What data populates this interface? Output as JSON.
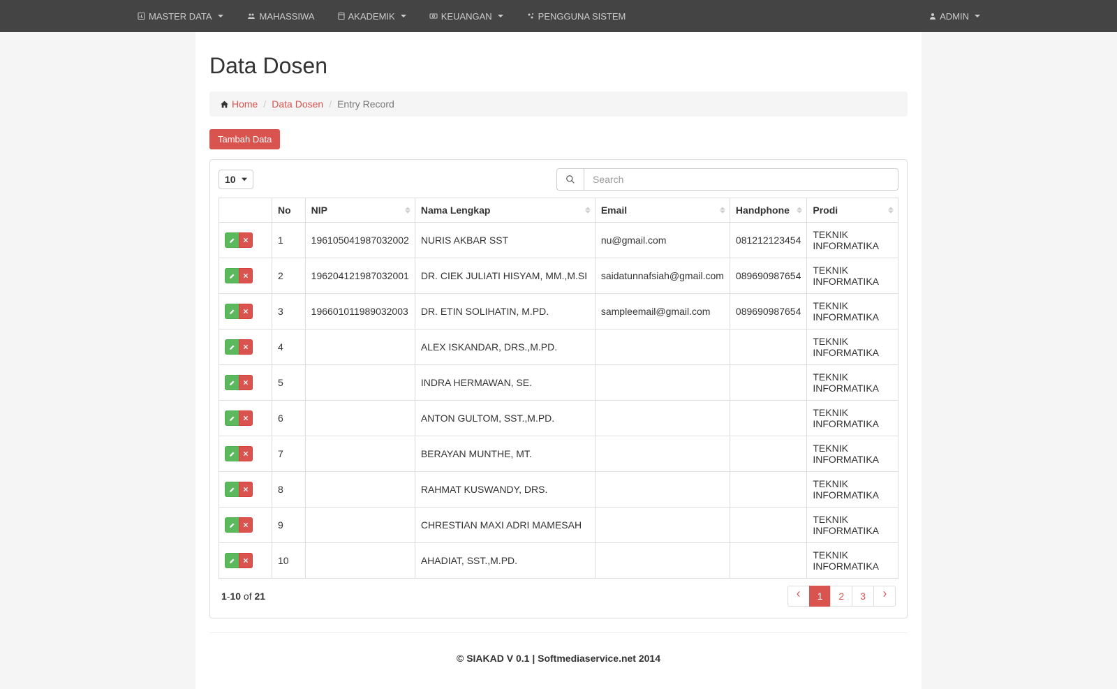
{
  "nav": {
    "left": [
      {
        "icon": "bar-chart-icon",
        "label": "MASTER DATA",
        "caret": true
      },
      {
        "icon": "users-icon",
        "label": "MAHASSIWA",
        "caret": false
      },
      {
        "icon": "book-icon",
        "label": "AKADEMIK",
        "caret": true
      },
      {
        "icon": "money-icon",
        "label": "KEUANGAN",
        "caret": true
      },
      {
        "icon": "cogs-icon",
        "label": "PENGGUNA SISTEM",
        "caret": false
      }
    ],
    "right": {
      "icon": "user-icon",
      "label": "ADMIN",
      "caret": true
    }
  },
  "page": {
    "title": "Data Dosen"
  },
  "breadcrumb": {
    "home": "Home",
    "mid": "Data Dosen",
    "active": "Entry Record"
  },
  "buttons": {
    "add": "Tambah Data"
  },
  "controls": {
    "page_size": "10",
    "search_placeholder": "Search"
  },
  "table": {
    "headers": {
      "no": "No",
      "nip": "NIP",
      "nama": "Nama Lengkap",
      "email": "Email",
      "hp": "Handphone",
      "prodi": "Prodi"
    },
    "rows": [
      {
        "no": "1",
        "nip": "196105041987032002",
        "nama": "NURIS AKBAR SST",
        "email": "nu@gmail.com",
        "hp": "081212123454",
        "prodi": "TEKNIK INFORMATIKA"
      },
      {
        "no": "2",
        "nip": "196204121987032001",
        "nama": "DR. CIEK JULIATI HISYAM, MM.,M.SI",
        "email": "saidatunnafsiah@gmail.com",
        "hp": "089690987654",
        "prodi": "TEKNIK INFORMATIKA"
      },
      {
        "no": "3",
        "nip": "196601011989032003",
        "nama": "DR. ETIN SOLIHATIN, M.PD.",
        "email": "sampleemail@gmail.com",
        "hp": "089690987654",
        "prodi": "TEKNIK INFORMATIKA"
      },
      {
        "no": "4",
        "nip": "",
        "nama": "ALEX ISKANDAR, DRS.,M.PD.",
        "email": "",
        "hp": "",
        "prodi": "TEKNIK INFORMATIKA"
      },
      {
        "no": "5",
        "nip": "",
        "nama": "INDRA HERMAWAN, SE.",
        "email": "",
        "hp": "",
        "prodi": "TEKNIK INFORMATIKA"
      },
      {
        "no": "6",
        "nip": "",
        "nama": "ANTON GULTOM, SST.,M.PD.",
        "email": "",
        "hp": "",
        "prodi": "TEKNIK INFORMATIKA"
      },
      {
        "no": "7",
        "nip": "",
        "nama": "BERAYAN MUNTHE, MT.",
        "email": "",
        "hp": "",
        "prodi": "TEKNIK INFORMATIKA"
      },
      {
        "no": "8",
        "nip": "",
        "nama": "RAHMAT KUSWANDY, DRS.",
        "email": "",
        "hp": "",
        "prodi": "TEKNIK INFORMATIKA"
      },
      {
        "no": "9",
        "nip": "",
        "nama": "CHRESTIAN MAXI ADRI MAMESAH",
        "email": "",
        "hp": "",
        "prodi": "TEKNIK INFORMATIKA"
      },
      {
        "no": "10",
        "nip": "",
        "nama": "AHADIAT, SST.,M.PD.",
        "email": "",
        "hp": "",
        "prodi": "TEKNIK INFORMATIKA"
      }
    ]
  },
  "footer": {
    "from": "1",
    "to": "10",
    "of_label": " of ",
    "total": "21"
  },
  "pagination": {
    "pages": [
      "1",
      "2",
      "3"
    ],
    "active": "1"
  },
  "copyright": "© SIAKAD V 0.1 | Softmediaservice.net 2014"
}
